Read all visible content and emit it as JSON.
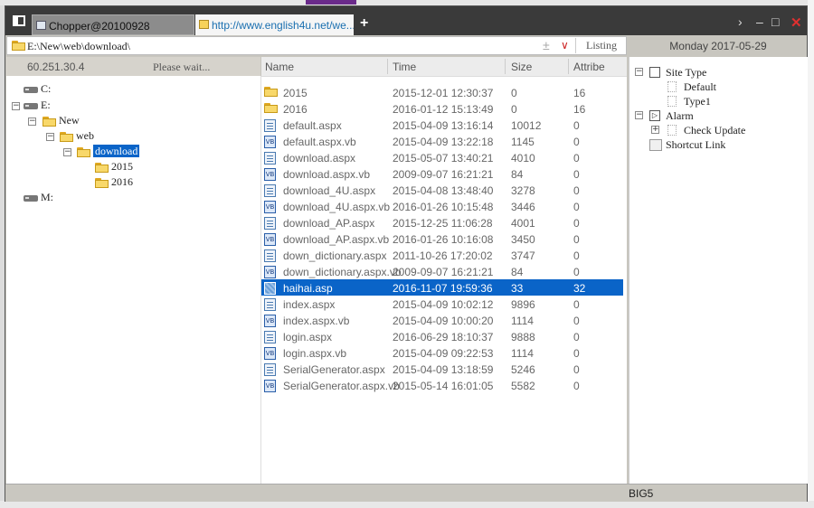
{
  "tabs": [
    {
      "label": "Chopper@20100928"
    },
    {
      "label": "http://www.english4u.net/we..."
    }
  ],
  "toolbar": {
    "add_tab": "+",
    "chevron": "›",
    "minimize": "–",
    "maximize": "□",
    "close": "✕"
  },
  "address": {
    "path": "E:\\New\\web\\download\\",
    "plus": "±",
    "dropdown": "∨",
    "listing_label": "Listing"
  },
  "date_label": "Monday 2017-05-29",
  "status": {
    "ip": "60.251.30.4",
    "wait": "Please wait...",
    "encoding": "BIG5"
  },
  "tree": {
    "drive_c": "C:",
    "drive_e": "E:",
    "folder_new": "New",
    "folder_web": "web",
    "folder_download": "download",
    "folder_2015": "2015",
    "folder_2016": "2016",
    "drive_m": "M:",
    "collapse": "−"
  },
  "columns": {
    "name": "Name",
    "time": "Time",
    "size": "Size",
    "attrib": "Attribe"
  },
  "files": [
    {
      "name": "2015",
      "time": "2015-12-01 12:30:37",
      "size": "0",
      "attrib": "16",
      "icon": "folder"
    },
    {
      "name": "2016",
      "time": "2016-01-12 15:13:49",
      "size": "0",
      "attrib": "16",
      "icon": "folder"
    },
    {
      "name": "default.aspx",
      "time": "2015-04-09 13:16:14",
      "size": "10012",
      "attrib": "0",
      "icon": "page"
    },
    {
      "name": "default.aspx.vb",
      "time": "2015-04-09 13:22:18",
      "size": "1145",
      "attrib": "0",
      "icon": "vb"
    },
    {
      "name": "download.aspx",
      "time": "2015-05-07 13:40:21",
      "size": "4010",
      "attrib": "0",
      "icon": "page"
    },
    {
      "name": "download.aspx.vb",
      "time": "2009-09-07 16:21:21",
      "size": "84",
      "attrib": "0",
      "icon": "vb"
    },
    {
      "name": "download_4U.aspx",
      "time": "2015-04-08 13:48:40",
      "size": "3278",
      "attrib": "0",
      "icon": "page"
    },
    {
      "name": "download_4U.aspx.vb",
      "time": "2016-01-26 10:15:48",
      "size": "3446",
      "attrib": "0",
      "icon": "vb"
    },
    {
      "name": "download_AP.aspx",
      "time": "2015-12-25 11:06:28",
      "size": "4001",
      "attrib": "0",
      "icon": "page"
    },
    {
      "name": "download_AP.aspx.vb",
      "time": "2016-01-26 10:16:08",
      "size": "3450",
      "attrib": "0",
      "icon": "vb"
    },
    {
      "name": "down_dictionary.aspx",
      "time": "2011-10-26 17:20:02",
      "size": "3747",
      "attrib": "0",
      "icon": "page"
    },
    {
      "name": "down_dictionary.aspx.vb",
      "time": "2009-09-07 16:21:21",
      "size": "84",
      "attrib": "0",
      "icon": "vb"
    },
    {
      "name": "haihai.asp",
      "time": "2016-11-07 19:59:36",
      "size": "33",
      "attrib": "32",
      "icon": "asp"
    },
    {
      "name": "index.aspx",
      "time": "2015-04-09 10:02:12",
      "size": "9896",
      "attrib": "0",
      "icon": "page"
    },
    {
      "name": "index.aspx.vb",
      "time": "2015-04-09 10:00:20",
      "size": "1114",
      "attrib": "0",
      "icon": "vb"
    },
    {
      "name": "login.aspx",
      "time": "2016-06-29 18:10:37",
      "size": "9888",
      "attrib": "0",
      "icon": "page"
    },
    {
      "name": "login.aspx.vb",
      "time": "2015-04-09 09:22:53",
      "size": "1114",
      "attrib": "0",
      "icon": "vb"
    },
    {
      "name": "SerialGenerator.aspx",
      "time": "2015-04-09 13:18:59",
      "size": "5246",
      "attrib": "0",
      "icon": "page"
    },
    {
      "name": "SerialGenerator.aspx.vb",
      "time": "2015-05-14 16:01:05",
      "size": "5582",
      "attrib": "0",
      "icon": "vb"
    }
  ],
  "selected_file_index": 12,
  "right_tree": {
    "site_type": "Site Type",
    "default": "Default",
    "type1": "Type1",
    "alarm": "Alarm",
    "check_update": "Check Update",
    "shortcut_link": "Shortcut Link",
    "collapse": "−",
    "expand": "+"
  }
}
